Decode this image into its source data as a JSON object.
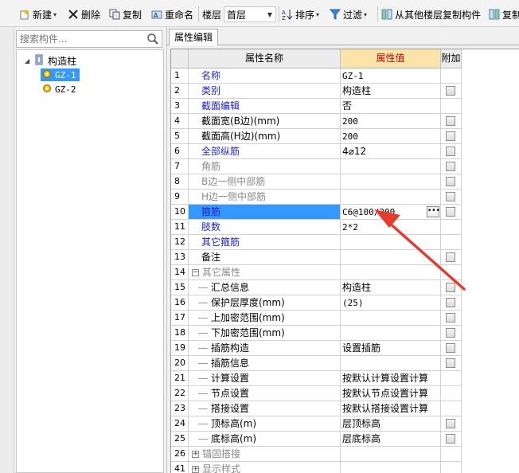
{
  "toolbar": {
    "new_label": "新建",
    "delete_label": "删除",
    "copy_label": "复制",
    "rename_label": "重命名",
    "floor_label": "楼层",
    "floor_value": "首层",
    "sort_label": "排序",
    "filter_label": "过滤",
    "copy_from_label": "从其他楼层复制构件",
    "copy_to_label": "复制"
  },
  "search": {
    "placeholder": "搜索构件..."
  },
  "tree": {
    "root_label": "构造柱",
    "children": [
      {
        "label": "GZ-1",
        "selected": true
      },
      {
        "label": "GZ-2",
        "selected": false
      }
    ]
  },
  "tab": {
    "label": "属性编辑"
  },
  "grid": {
    "headers": {
      "name": "属性名称",
      "value": "属性值",
      "extra": "附加"
    },
    "rows": [
      {
        "num": "1",
        "name": "名称",
        "value": "GZ-1",
        "color": "blue",
        "check": false
      },
      {
        "num": "2",
        "name": "类别",
        "value": "构造柱",
        "color": "blue",
        "check": true
      },
      {
        "num": "3",
        "name": "截面编辑",
        "value": "否",
        "color": "blue",
        "check": false
      },
      {
        "num": "4",
        "name": "截面宽(B边)(mm)",
        "value": "200",
        "color": "black",
        "check": true
      },
      {
        "num": "5",
        "name": "截面高(H边)(mm)",
        "value": "200",
        "color": "black",
        "check": true
      },
      {
        "num": "6",
        "name": "全部纵筋",
        "value": "4⌀12",
        "color": "blue",
        "check": true
      },
      {
        "num": "7",
        "name": "角筋",
        "value": "",
        "color": "gray",
        "check": true
      },
      {
        "num": "8",
        "name": "B边一侧中部筋",
        "value": "",
        "color": "gray",
        "check": true
      },
      {
        "num": "9",
        "name": "H边一侧中部筋",
        "value": "",
        "color": "gray",
        "check": true
      },
      {
        "num": "10",
        "name": "箍筋",
        "value": "C6@100/200",
        "color": "blue",
        "check": true
      },
      {
        "num": "11",
        "name": "肢数",
        "value": "2*2",
        "color": "blue",
        "check": false
      },
      {
        "num": "12",
        "name": "其它箍筋",
        "value": "",
        "color": "blue",
        "check": false
      },
      {
        "num": "13",
        "name": "备注",
        "value": "",
        "color": "black",
        "check": true
      },
      {
        "num": "14",
        "name": "其它属性",
        "value": "",
        "color": "gray",
        "check": false
      },
      {
        "num": "15",
        "name": "汇总信息",
        "value": "构造柱",
        "color": "black",
        "check": true
      },
      {
        "num": "16",
        "name": "保护层厚度(mm)",
        "value": "(25)",
        "color": "black",
        "check": true
      },
      {
        "num": "17",
        "name": "上加密范围(mm)",
        "value": "",
        "color": "black",
        "check": true
      },
      {
        "num": "18",
        "name": "下加密范围(mm)",
        "value": "",
        "color": "black",
        "check": true
      },
      {
        "num": "19",
        "name": "插筋构造",
        "value": "设置插筋",
        "color": "black",
        "check": true
      },
      {
        "num": "20",
        "name": "插筋信息",
        "value": "",
        "color": "black",
        "check": true
      },
      {
        "num": "21",
        "name": "计算设置",
        "value": "按默认计算设置计算",
        "color": "black",
        "check": false
      },
      {
        "num": "22",
        "name": "节点设置",
        "value": "按默认节点设置计算",
        "color": "black",
        "check": false
      },
      {
        "num": "23",
        "name": "搭接设置",
        "value": "按默认搭接设置计算",
        "color": "black",
        "check": false
      },
      {
        "num": "24",
        "name": "顶标高(m)",
        "value": "层顶标高",
        "color": "black",
        "check": true
      },
      {
        "num": "25",
        "name": "底标高(m)",
        "value": "层底标高",
        "color": "black",
        "check": true
      },
      {
        "num": "26",
        "name": "锚固搭接",
        "value": "",
        "color": "gray",
        "check": false
      },
      {
        "num": "41",
        "name": "显示样式",
        "value": "",
        "color": "gray",
        "check": false
      }
    ]
  },
  "colors": {
    "selection": "#3399ff",
    "header_value_bg": "#fbe3a9",
    "header_value_text": "#c00000",
    "annotation_arrow": "#e8392f"
  }
}
